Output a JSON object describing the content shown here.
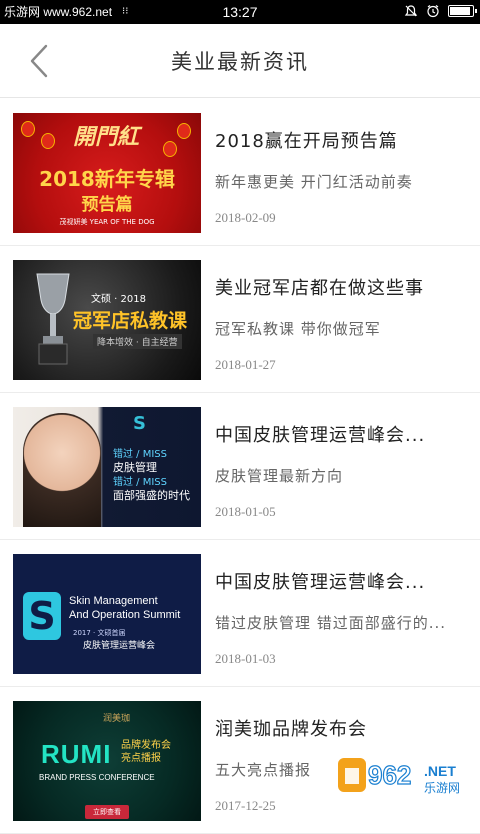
{
  "status_bar": {
    "site": "乐游网 www.962.net",
    "extra": "⁝⁝",
    "time": "13:27",
    "battery_level": 0.85
  },
  "header": {
    "title": "美业最新资讯",
    "back_icon": "chevron-left-icon"
  },
  "articles": [
    {
      "title": "2018赢在开局预告篇",
      "desc": "新年惠更美  开门红活动前奏",
      "date": "2018-02-09",
      "thumb": {
        "top": "開門紅",
        "big": "2018新年专辑",
        "small": "预告篇",
        "foot": "茂视妍美 YEAR OF THE DOG"
      }
    },
    {
      "title": "美业冠军店都在做这些事",
      "desc": "冠军私教课  带你做冠军",
      "date": "2018-01-27",
      "thumb": {
        "line1": "文硕 · 2018",
        "line2": "冠军店私教课",
        "line3": "降本增效 · 自主经营"
      }
    },
    {
      "title": "中国皮肤管理运营峰会...",
      "desc": "皮肤管理最新方向",
      "date": "2018-01-05",
      "thumb": {
        "l1": "错过 / MISS",
        "l2": "皮肤管理",
        "l3": "错过 / MISS",
        "l4": "面部强盛的时代"
      }
    },
    {
      "title": "中国皮肤管理运营峰会...",
      "desc": "错过皮肤管理  错过面部盛行的...",
      "date": "2018-01-03",
      "thumb": {
        "en": "Skin Management\nAnd Operation Summit",
        "sub": "2017 · 文硕首届",
        "cn": "皮肤管理运营峰会"
      }
    },
    {
      "title": "润美珈品牌发布会",
      "desc": "五大亮点播报",
      "date": "2017-12-25",
      "thumb": {
        "brand": "润美珈",
        "rumi": "RUMI",
        "tag1": "品牌发布会",
        "tag2": "亮点播报",
        "bpc": "BRAND PRESS CONFERENCE",
        "btn": "立即查看"
      }
    }
  ],
  "watermark": {
    "text": "962",
    "sub": "乐游网",
    "net": ".NET"
  },
  "colors": {
    "header_text": "#333333",
    "title_text": "#222222",
    "desc_text": "#666666",
    "date_text": "#888888",
    "divider": "#ececec"
  }
}
